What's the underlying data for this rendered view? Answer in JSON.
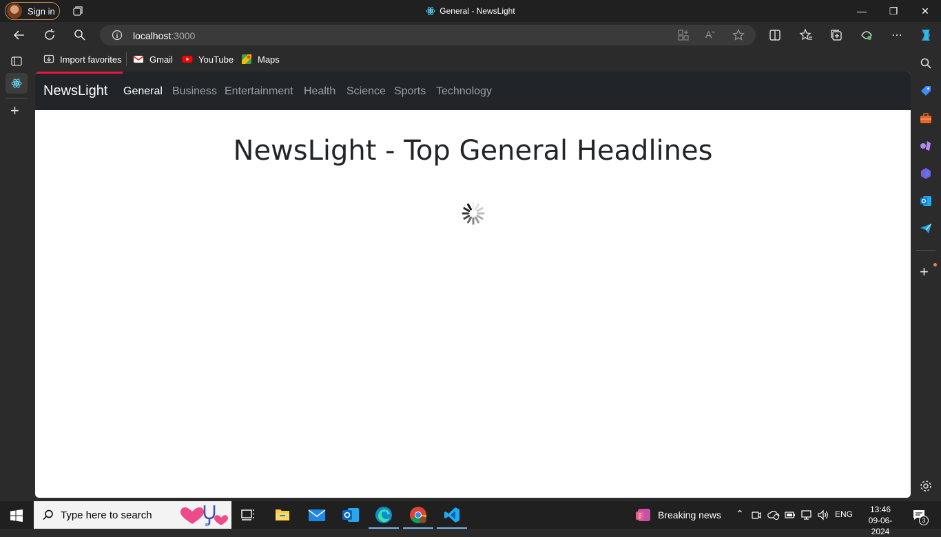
{
  "window": {
    "title": "General - NewsLight",
    "signin_label": "Sign in"
  },
  "address": {
    "host": "localhost",
    "port": ":3000"
  },
  "favorites": [
    {
      "label": "Import favorites",
      "icon": "import-favorites-icon"
    },
    {
      "label": "Gmail",
      "icon": "gmail-icon"
    },
    {
      "label": "YouTube",
      "icon": "youtube-icon"
    },
    {
      "label": "Maps",
      "icon": "maps-icon"
    }
  ],
  "app": {
    "brand": "NewsLight",
    "nav": [
      "General",
      "Business",
      "Entertainment",
      "Health",
      "Science",
      "Sports",
      "Technology"
    ],
    "active_nav": "General",
    "heading": "NewsLight - Top General Headlines",
    "accent": "#e8173f",
    "navbar_bg": "#212529"
  },
  "taskbar": {
    "search_placeholder": "Type here to search",
    "news_label": "Breaking news",
    "language": "ENG",
    "time": "13:46",
    "date": "09-06-2024",
    "notification_count": "3"
  }
}
